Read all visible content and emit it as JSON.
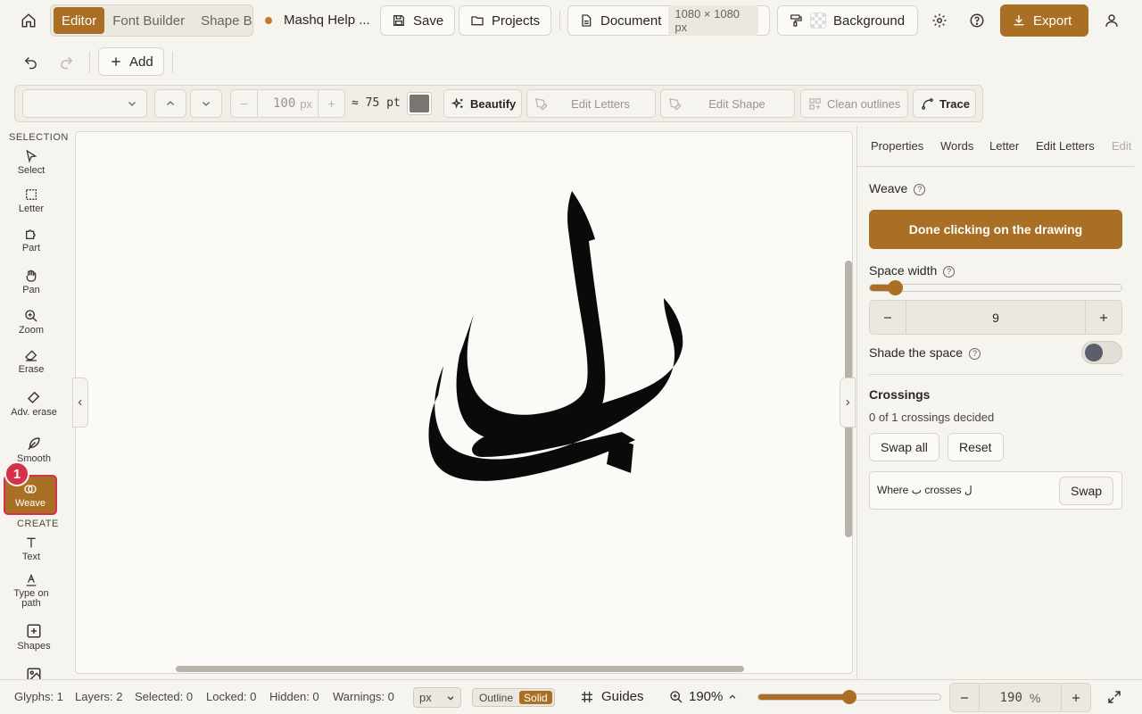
{
  "topbar": {
    "tabs": [
      {
        "label": "Editor",
        "active": true
      },
      {
        "label": "Font Builder",
        "active": false
      },
      {
        "label": "Shape Builder",
        "active": false
      }
    ],
    "project_title": "Mashq Help ...",
    "save_label": "Save",
    "projects_label": "Projects",
    "document_label": "Document",
    "document_size": "1080 × 1080 px",
    "background_label": "Background",
    "export_label": "Export"
  },
  "row2": {
    "add_label": "Add"
  },
  "toolbar": {
    "font_size_value": "100",
    "font_size_unit": "px",
    "pt_value": "≈ 75 pt",
    "beautify_label": "Beautify",
    "edit_letters_label": "Edit Letters",
    "edit_shape_label": "Edit Shape",
    "clean_outlines_label": "Clean outlines",
    "trace_label": "Trace"
  },
  "leftpanel": {
    "selection_heading": "SELECTION",
    "create_heading": "CREATE",
    "tools": {
      "select": "Select",
      "letter": "Letter",
      "part": "Part",
      "pan": "Pan",
      "zoom": "Zoom",
      "erase": "Erase",
      "adv_erase": "Adv. erase",
      "smooth": "Smooth",
      "weave": "Weave",
      "text": "Text",
      "type_on_path": "Type on path",
      "shapes": "Shapes"
    },
    "weave_badge": "1"
  },
  "rightpanel": {
    "tabs": [
      "Properties",
      "Words",
      "Letter",
      "Edit Letters",
      "Edit"
    ],
    "weave_title": "Weave",
    "done_button": "Done clicking on the drawing",
    "space_width_label": "Space width",
    "space_width_value": "9",
    "space_width_fraction": 0.1,
    "shade_label": "Shade the space",
    "crossings_title": "Crossings",
    "crossings_status": "0 of 1 crossings decided",
    "swap_all_label": "Swap all",
    "reset_label": "Reset",
    "crossing_item": "Where ب crosses ل",
    "swap_label": "Swap"
  },
  "status": {
    "glyphs": "Glyphs: 1",
    "layers": "Layers: 2",
    "selected": "Selected: 0",
    "locked": "Locked: 0",
    "hidden": "Hidden: 0",
    "warnings": "Warnings: 0",
    "unit": "px",
    "outline_label": "Outline",
    "solid_label": "Solid",
    "guides_label": "Guides",
    "zoom_readout": "190%",
    "zoom_value": "190",
    "zoom_unit": "%",
    "zoom_fraction": 0.5
  },
  "colors": {
    "accent": "#a86f25",
    "highlight": "#d6304a",
    "background": "#f6f4ef",
    "canvas": "#fbfaf6"
  }
}
